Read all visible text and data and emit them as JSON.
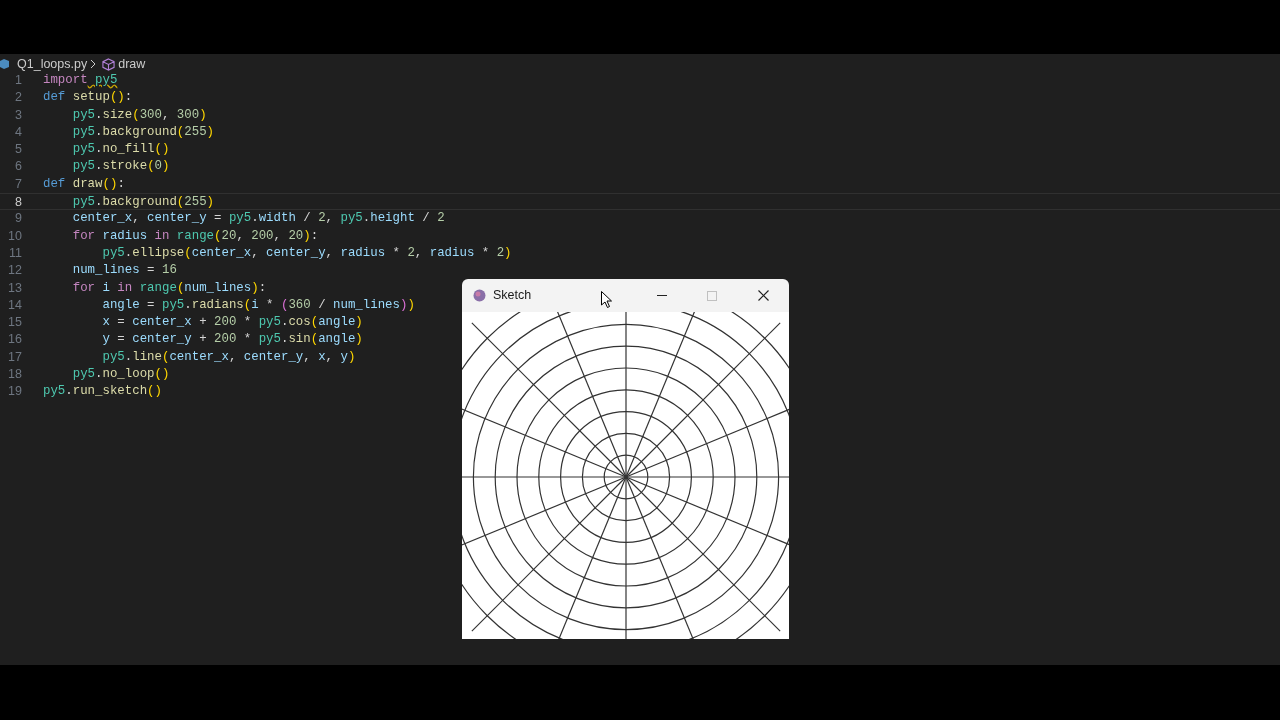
{
  "breadcrumb": {
    "file": "Q1_loops.py",
    "symbol": "draw"
  },
  "lines": [
    {
      "number": "1",
      "active": false,
      "tokens": [
        {
          "kind": "control",
          "text": "import"
        },
        {
          "kind": "module",
          "text": " py5",
          "warn": true
        }
      ]
    },
    {
      "number": "2",
      "active": false,
      "tokens": [
        {
          "kind": "keyword",
          "text": "def"
        },
        {
          "kind": "function",
          "text": " setup"
        },
        {
          "kind": "paren",
          "text": "()"
        },
        {
          "kind": "plain",
          "text": ":"
        }
      ]
    },
    {
      "number": "3",
      "active": false,
      "tokens": [
        {
          "kind": "module",
          "text": "    py5"
        },
        {
          "kind": "plain",
          "text": "."
        },
        {
          "kind": "function",
          "text": "size"
        },
        {
          "kind": "paren",
          "text": "("
        },
        {
          "kind": "number",
          "text": "300"
        },
        {
          "kind": "plain",
          "text": ","
        },
        {
          "kind": "number",
          "text": " 300"
        },
        {
          "kind": "paren",
          "text": ")"
        }
      ]
    },
    {
      "number": "4",
      "active": false,
      "tokens": [
        {
          "kind": "module",
          "text": "    py5"
        },
        {
          "kind": "plain",
          "text": "."
        },
        {
          "kind": "function",
          "text": "background"
        },
        {
          "kind": "paren",
          "text": "("
        },
        {
          "kind": "number",
          "text": "255"
        },
        {
          "kind": "paren",
          "text": ")"
        }
      ]
    },
    {
      "number": "5",
      "active": false,
      "tokens": [
        {
          "kind": "module",
          "text": "    py5"
        },
        {
          "kind": "plain",
          "text": "."
        },
        {
          "kind": "function",
          "text": "no_fill"
        },
        {
          "kind": "paren",
          "text": "()"
        }
      ]
    },
    {
      "number": "6",
      "active": false,
      "tokens": [
        {
          "kind": "module",
          "text": "    py5"
        },
        {
          "kind": "plain",
          "text": "."
        },
        {
          "kind": "function",
          "text": "stroke"
        },
        {
          "kind": "paren",
          "text": "("
        },
        {
          "kind": "number",
          "text": "0"
        },
        {
          "kind": "paren",
          "text": ")"
        }
      ]
    },
    {
      "number": "7",
      "active": false,
      "tokens": [
        {
          "kind": "keyword",
          "text": "def"
        },
        {
          "kind": "function",
          "text": " draw"
        },
        {
          "kind": "paren",
          "text": "()"
        },
        {
          "kind": "plain",
          "text": ":"
        }
      ]
    },
    {
      "number": "8",
      "active": true,
      "tokens": [
        {
          "kind": "module",
          "text": "    py5"
        },
        {
          "kind": "plain",
          "text": "."
        },
        {
          "kind": "function",
          "text": "background"
        },
        {
          "kind": "paren",
          "text": "("
        },
        {
          "kind": "number",
          "text": "255"
        },
        {
          "kind": "paren",
          "text": ")"
        }
      ]
    },
    {
      "number": "9",
      "active": false,
      "tokens": [
        {
          "kind": "variable",
          "text": "    center_x"
        },
        {
          "kind": "plain",
          "text": ","
        },
        {
          "kind": "variable",
          "text": " center_y"
        },
        {
          "kind": "plain",
          "text": " ="
        },
        {
          "kind": "module",
          "text": " py5"
        },
        {
          "kind": "plain",
          "text": "."
        },
        {
          "kind": "variable",
          "text": "width"
        },
        {
          "kind": "plain",
          "text": " /"
        },
        {
          "kind": "number",
          "text": " 2"
        },
        {
          "kind": "plain",
          "text": ","
        },
        {
          "kind": "module",
          "text": " py5"
        },
        {
          "kind": "plain",
          "text": "."
        },
        {
          "kind": "variable",
          "text": "height"
        },
        {
          "kind": "plain",
          "text": " /"
        },
        {
          "kind": "number",
          "text": " 2"
        }
      ]
    },
    {
      "number": "10",
      "active": false,
      "tokens": [
        {
          "kind": "control",
          "text": "    for"
        },
        {
          "kind": "variable",
          "text": " radius"
        },
        {
          "kind": "control",
          "text": " in"
        },
        {
          "kind": "module",
          "text": " range"
        },
        {
          "kind": "paren",
          "text": "("
        },
        {
          "kind": "number",
          "text": "20"
        },
        {
          "kind": "plain",
          "text": ","
        },
        {
          "kind": "number",
          "text": " 200"
        },
        {
          "kind": "plain",
          "text": ","
        },
        {
          "kind": "number",
          "text": " 20"
        },
        {
          "kind": "paren",
          "text": ")"
        },
        {
          "kind": "plain",
          "text": ":"
        }
      ]
    },
    {
      "number": "11",
      "active": false,
      "tokens": [
        {
          "kind": "module",
          "text": "        py5"
        },
        {
          "kind": "plain",
          "text": "."
        },
        {
          "kind": "function",
          "text": "ellipse"
        },
        {
          "kind": "paren",
          "text": "("
        },
        {
          "kind": "variable",
          "text": "center_x"
        },
        {
          "kind": "plain",
          "text": ","
        },
        {
          "kind": "variable",
          "text": " center_y"
        },
        {
          "kind": "plain",
          "text": ","
        },
        {
          "kind": "variable",
          "text": " radius"
        },
        {
          "kind": "plain",
          "text": " *"
        },
        {
          "kind": "number",
          "text": " 2"
        },
        {
          "kind": "plain",
          "text": ","
        },
        {
          "kind": "variable",
          "text": " radius"
        },
        {
          "kind": "plain",
          "text": " *"
        },
        {
          "kind": "number",
          "text": " 2"
        },
        {
          "kind": "paren",
          "text": ")"
        }
      ]
    },
    {
      "number": "12",
      "active": false,
      "tokens": [
        {
          "kind": "variable",
          "text": "    num_lines"
        },
        {
          "kind": "plain",
          "text": " ="
        },
        {
          "kind": "number",
          "text": " 16"
        }
      ]
    },
    {
      "number": "13",
      "active": false,
      "tokens": [
        {
          "kind": "control",
          "text": "    for"
        },
        {
          "kind": "variable",
          "text": " i"
        },
        {
          "kind": "control",
          "text": " in"
        },
        {
          "kind": "module",
          "text": " range"
        },
        {
          "kind": "paren",
          "text": "("
        },
        {
          "kind": "variable",
          "text": "num_lines"
        },
        {
          "kind": "paren",
          "text": ")"
        },
        {
          "kind": "plain",
          "text": ":"
        }
      ]
    },
    {
      "number": "14",
      "active": false,
      "tokens": [
        {
          "kind": "variable",
          "text": "        angle"
        },
        {
          "kind": "plain",
          "text": " ="
        },
        {
          "kind": "module",
          "text": " py5"
        },
        {
          "kind": "plain",
          "text": "."
        },
        {
          "kind": "function",
          "text": "radians"
        },
        {
          "kind": "paren",
          "text": "("
        },
        {
          "kind": "variable",
          "text": "i"
        },
        {
          "kind": "plain",
          "text": " *"
        },
        {
          "kind": "inner_paren",
          "text": " ("
        },
        {
          "kind": "number",
          "text": "360"
        },
        {
          "kind": "plain",
          "text": " /"
        },
        {
          "kind": "variable",
          "text": " num_lines"
        },
        {
          "kind": "inner_paren",
          "text": ")"
        },
        {
          "kind": "paren",
          "text": ")"
        }
      ]
    },
    {
      "number": "15",
      "active": false,
      "tokens": [
        {
          "kind": "variable",
          "text": "        x"
        },
        {
          "kind": "plain",
          "text": " ="
        },
        {
          "kind": "variable",
          "text": " center_x"
        },
        {
          "kind": "plain",
          "text": " +"
        },
        {
          "kind": "number",
          "text": " 200"
        },
        {
          "kind": "plain",
          "text": " *"
        },
        {
          "kind": "module",
          "text": " py5"
        },
        {
          "kind": "plain",
          "text": "."
        },
        {
          "kind": "function",
          "text": "cos"
        },
        {
          "kind": "paren",
          "text": "("
        },
        {
          "kind": "variable",
          "text": "angle"
        },
        {
          "kind": "paren",
          "text": ")"
        }
      ]
    },
    {
      "number": "16",
      "active": false,
      "tokens": [
        {
          "kind": "variable",
          "text": "        y"
        },
        {
          "kind": "plain",
          "text": " ="
        },
        {
          "kind": "variable",
          "text": " center_y"
        },
        {
          "kind": "plain",
          "text": " +"
        },
        {
          "kind": "number",
          "text": " 200"
        },
        {
          "kind": "plain",
          "text": " *"
        },
        {
          "kind": "module",
          "text": " py5"
        },
        {
          "kind": "plain",
          "text": "."
        },
        {
          "kind": "function",
          "text": "sin"
        },
        {
          "kind": "paren",
          "text": "("
        },
        {
          "kind": "variable",
          "text": "angle"
        },
        {
          "kind": "paren",
          "text": ")"
        }
      ]
    },
    {
      "number": "17",
      "active": false,
      "tokens": [
        {
          "kind": "module",
          "text": "        py5"
        },
        {
          "kind": "plain",
          "text": "."
        },
        {
          "kind": "function",
          "text": "line"
        },
        {
          "kind": "paren",
          "text": "("
        },
        {
          "kind": "variable",
          "text": "center_x"
        },
        {
          "kind": "plain",
          "text": ","
        },
        {
          "kind": "variable",
          "text": " center_y"
        },
        {
          "kind": "plain",
          "text": ","
        },
        {
          "kind": "variable",
          "text": " x"
        },
        {
          "kind": "plain",
          "text": ","
        },
        {
          "kind": "variable",
          "text": " y"
        },
        {
          "kind": "paren",
          "text": ")"
        }
      ]
    },
    {
      "number": "18",
      "active": false,
      "tokens": [
        {
          "kind": "module",
          "text": "    py5"
        },
        {
          "kind": "plain",
          "text": "."
        },
        {
          "kind": "function",
          "text": "no_loop"
        },
        {
          "kind": "paren",
          "text": "()"
        }
      ]
    },
    {
      "number": "19",
      "active": false,
      "tokens": [
        {
          "kind": "module",
          "text": "py5"
        },
        {
          "kind": "plain",
          "text": "."
        },
        {
          "kind": "function",
          "text": "run_sketch"
        },
        {
          "kind": "paren",
          "text": "()"
        }
      ]
    }
  ],
  "sketch_window": {
    "title": "Sketch"
  }
}
